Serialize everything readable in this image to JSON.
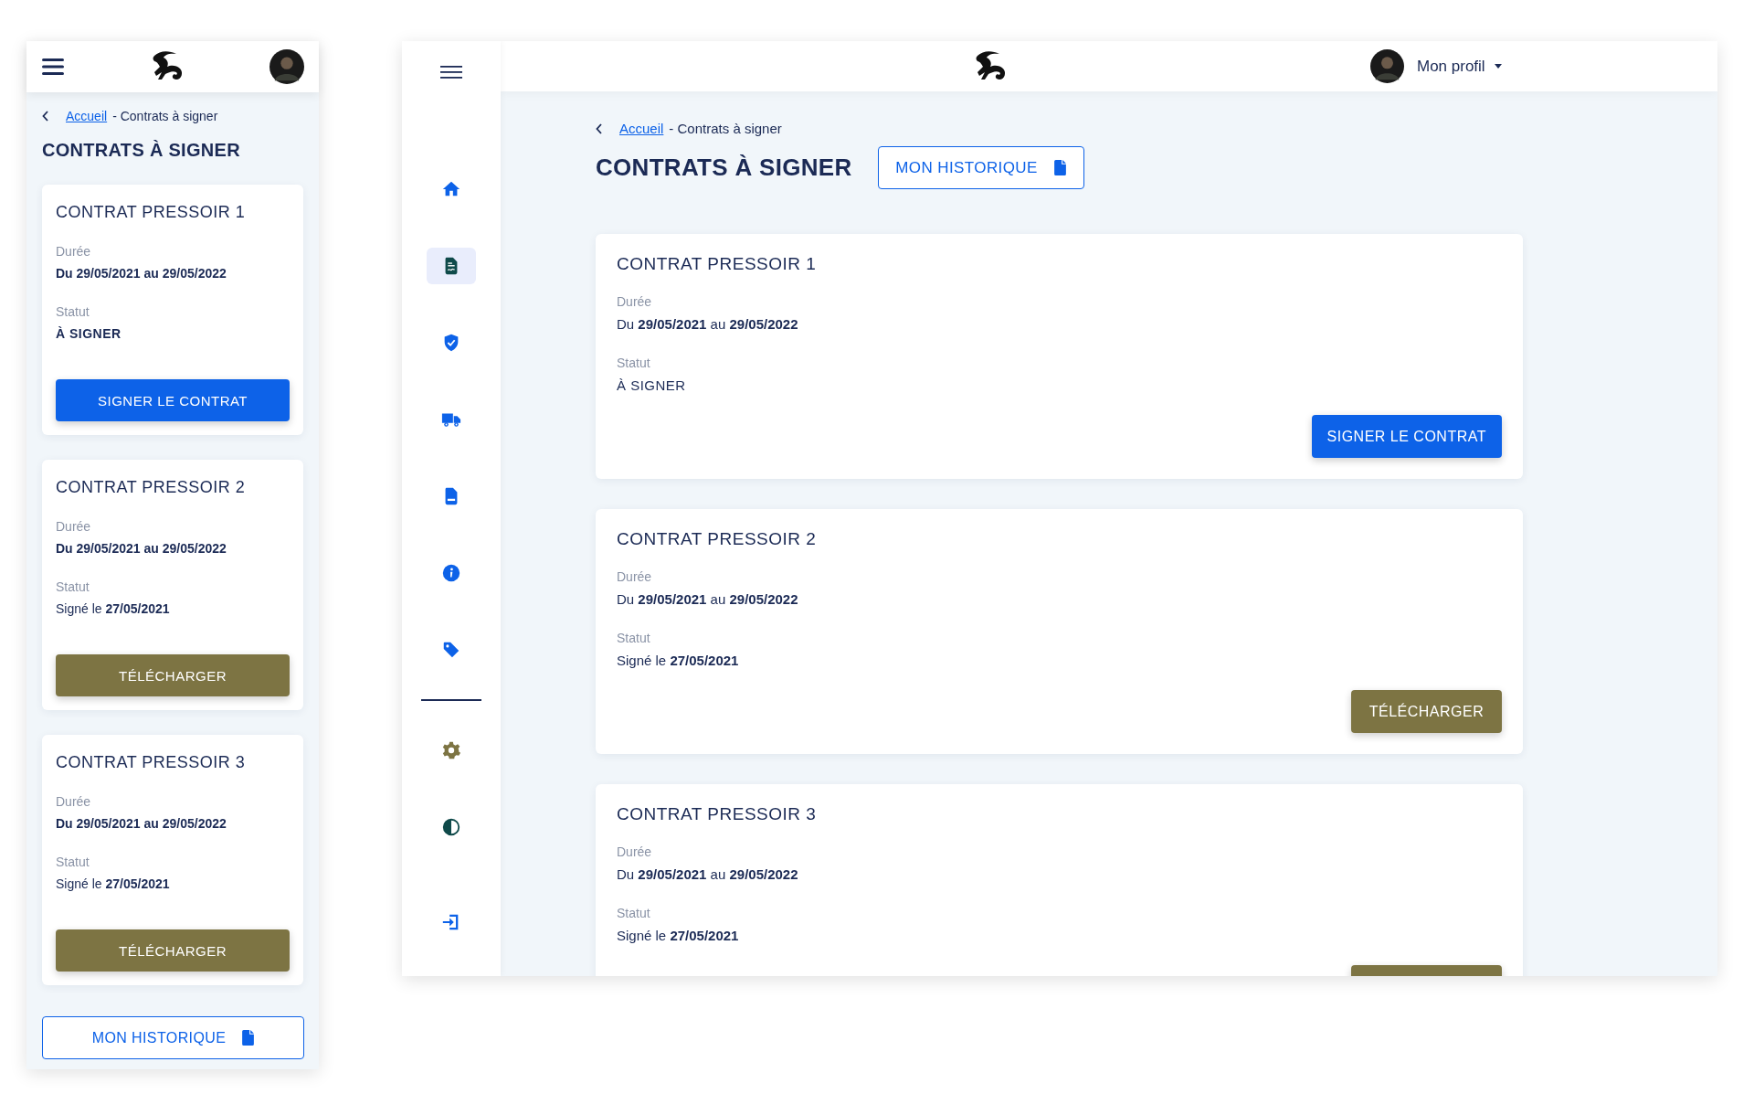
{
  "mobile": {
    "breadcrumb": {
      "link": "Accueil",
      "current": "- Contrats à signer"
    },
    "title": "CONTRATS À SIGNER",
    "cards": [
      {
        "kind": "pending",
        "title": "CONTRAT PRESSOIR 1",
        "duration_label": "Durée",
        "duration": "Du 29/05/2021 au 29/05/2022",
        "status_label": "Statut",
        "status": "À SIGNER",
        "button": {
          "kind": "sign",
          "label": "SIGNER LE CONTRAT"
        }
      },
      {
        "kind": "signed",
        "title": "CONTRAT PRESSOIR 2",
        "duration_label": "Durée",
        "duration": "Du 29/05/2021 au 29/05/2022",
        "status_label": "Statut",
        "status": "Signé le **27/05/2021**",
        "button": {
          "kind": "download",
          "label": "TÉLÉCHARGER"
        }
      },
      {
        "kind": "signed",
        "title": "CONTRAT PRESSOIR 3",
        "duration_label": "Durée",
        "duration": "Du 29/05/2021 au 29/05/2022",
        "status_label": "Statut",
        "status": "Signé le **27/05/2021**",
        "button": {
          "kind": "download",
          "label": "TÉLÉCHARGER"
        }
      }
    ],
    "history_button": "MON HISTORIQUE"
  },
  "desktop": {
    "sidebar": {
      "items": [
        {
          "kind": "home",
          "selected": false
        },
        {
          "kind": "contract",
          "selected": true
        },
        {
          "kind": "shield",
          "selected": false
        },
        {
          "kind": "truck",
          "selected": false
        },
        {
          "kind": "doc",
          "selected": false
        },
        {
          "kind": "info",
          "selected": false
        },
        {
          "kind": "tag",
          "selected": false
        },
        {
          "kind": "divider"
        },
        {
          "kind": "gear",
          "selected": false
        },
        {
          "kind": "contrast",
          "selected": false
        },
        {
          "kind": "logout",
          "selected": false
        }
      ]
    },
    "profile": "Mon profil",
    "breadcrumb": {
      "link": "Accueil",
      "current": "- Contrats à signer"
    },
    "title": "CONTRATS À SIGNER",
    "history_button": "MON HISTORIQUE",
    "cards": [
      {
        "kind": "pending",
        "title": "CONTRAT PRESSOIR 1",
        "duration_label": "Durée",
        "duration": "Du **29/05/2021** au **29/05/2022**",
        "status_label": "Statut",
        "status": "À SIGNER",
        "button": {
          "kind": "sign",
          "label": "SIGNER LE CONTRAT"
        }
      },
      {
        "kind": "signed",
        "title": "CONTRAT PRESSOIR 2",
        "duration_label": "Durée",
        "duration": "Du **29/05/2021** au **29/05/2022**",
        "status_label": "Statut",
        "status": "Signé le **27/05/2021**",
        "button": {
          "kind": "download",
          "label": "TÉLÉCHARGER"
        }
      },
      {
        "kind": "signed",
        "title": "CONTRAT PRESSOIR 3",
        "duration_label": "Durée",
        "duration": "Du **29/05/2021** au **29/05/2022**",
        "status_label": "Statut",
        "status": "Signé le **27/05/2021**",
        "button": {
          "kind": "download"
        }
      }
    ]
  }
}
